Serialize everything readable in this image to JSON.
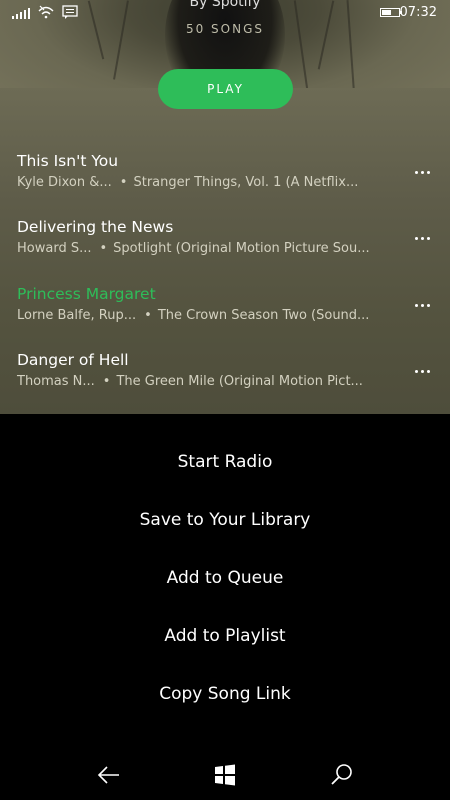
{
  "status": {
    "time": "07:32",
    "battery_level": 0.55
  },
  "playlist": {
    "by_line": "By Spotify",
    "song_count": "50 SONGS",
    "play_label": "PLAY"
  },
  "tracks": [
    {
      "title": "This Isn't You",
      "artist": "Kyle Dixon &...",
      "album": "Stranger Things, Vol. 1 (A Netflix...",
      "playing": false
    },
    {
      "title": "Delivering the News",
      "artist": "Howard S...",
      "album": "Spotlight (Original Motion Picture Sou...",
      "playing": false
    },
    {
      "title": "Princess Margaret",
      "artist": "Lorne Balfe, Rup...",
      "album": "The Crown Season Two (Sound...",
      "playing": true
    },
    {
      "title": "Danger of Hell",
      "artist": "Thomas N...",
      "album": "The Green Mile (Original Motion Pict...",
      "playing": false
    }
  ],
  "separator": "•",
  "menu": {
    "start_radio": "Start Radio",
    "save_library": "Save to Your Library",
    "add_queue": "Add to Queue",
    "add_playlist": "Add to Playlist",
    "copy_link": "Copy Song Link"
  },
  "colors": {
    "accent": "#2ebd59",
    "panel": "#5e5c49",
    "menu_bg": "#000000"
  },
  "icons": {
    "status": [
      "signal-icon",
      "wifi-icon",
      "message-icon",
      "battery-icon"
    ],
    "nav": [
      "back-arrow-icon",
      "windows-start-icon",
      "search-icon"
    ],
    "track_more": "more-options-icon"
  }
}
